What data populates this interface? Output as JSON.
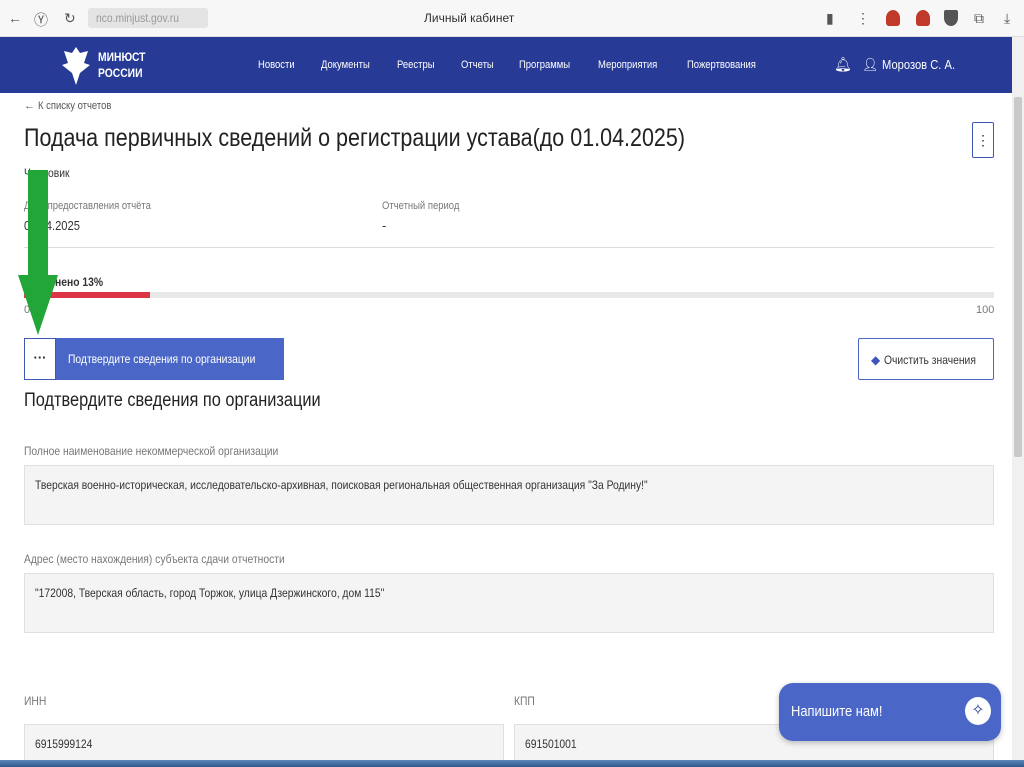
{
  "browser": {
    "url": "nco.minjust.gov.ru",
    "title": "Личный кабинет"
  },
  "header": {
    "brand_line1": "МИНЮСТ",
    "brand_line2": "РОССИИ",
    "nav": [
      "Новости",
      "Документы",
      "Реестры",
      "Отчеты",
      "Программы",
      "Мероприятия",
      "Пожертвования"
    ],
    "user": "Морозов С. А.",
    "color": "#263a96"
  },
  "page": {
    "back_link": "К списку отчетов",
    "title": "Подача первичных сведений о регистрации устава(до 01.04.2025)",
    "kebab": "⋮",
    "status": "Черновик",
    "date_label": "Дата предоставления отчёта",
    "date_value": "01.04.2025",
    "period_label": "Отчетный период",
    "period_value": "-",
    "progress_label": "Заполнено 13%",
    "progress_percent": 13,
    "progress_min": "0",
    "progress_max": "100"
  },
  "tabs": {
    "dots": "···",
    "active": "Подтвердите сведения по организации",
    "clear": "Очистить значения"
  },
  "form": {
    "heading": "Подтвердите сведения по организации",
    "full_name_label": "Полное наименование некоммерческой организации",
    "full_name": "Тверская военно-историческая, исследовательско-архивная, поисковая региональная общественная организация \"За Родину!\"",
    "address_label": "Адрес (место нахождения) субъекта сдачи отчетности",
    "address": "\"172008, Тверская область, город Торжок, улица Дзержинского, дом 115\"",
    "inn_label": "ИНН",
    "inn": "6915999124",
    "kpp_label": "КПП",
    "kpp": "691501001"
  },
  "chat": {
    "label": "Напишите нам!"
  },
  "colors": {
    "accent": "#4a67c8",
    "progress": "#dc3545",
    "arrow": "#22a637"
  }
}
